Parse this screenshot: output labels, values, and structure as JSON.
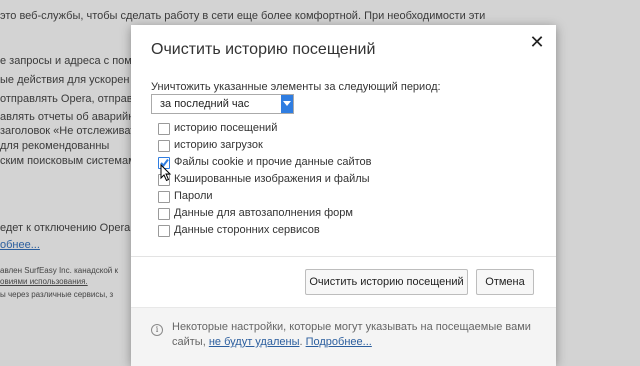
{
  "background": {
    "lines": [
      "это веб-службы, чтобы сделать работу в сети еще более комфортной. При необходимости эти",
      "е запросы и адреса с пом",
      "ые действия для ускорен",
      "отправлять Opera, отправля",
      "авлять отчеты об аварийн",
      "заголовок «Не отслеживать",
      "для рекомендованны",
      "ским поисковым системам",
      "едет к отключению Opera",
      "обнее..."
    ],
    "small_lines": [
      "авлен SurfEasy Inc. канадской к",
      "овиями использования.",
      "ы через различные сервисы, з"
    ]
  },
  "dialog": {
    "title": "Очистить историю посещений",
    "close_glyph": "✕",
    "period_label": "Уничтожить указанные элементы за следующий период:",
    "period_value": "за последний час",
    "options": [
      {
        "label": "историю посещений",
        "checked": false
      },
      {
        "label": "историю загрузок",
        "checked": false
      },
      {
        "label": "Файлы cookie и прочие данные сайтов",
        "checked": true
      },
      {
        "label": "Кэшированные изображения и файлы",
        "checked": false
      },
      {
        "label": "Пароли",
        "checked": false
      },
      {
        "label": "Данные для автозаполнения форм",
        "checked": false
      },
      {
        "label": "Данные сторонних сервисов",
        "checked": false
      }
    ],
    "clear_button": "Очистить историю посещений",
    "cancel_button": "Отмена",
    "footer": {
      "text1": "Некоторые настройки, которые могут указывать на посещаемые вами сайты,",
      "link1": "не будут удалены",
      "link2": "Подробнее...",
      "info_glyph": "i"
    }
  },
  "colors": {
    "accent": "#2f7de1",
    "link": "#2b5e9e"
  }
}
